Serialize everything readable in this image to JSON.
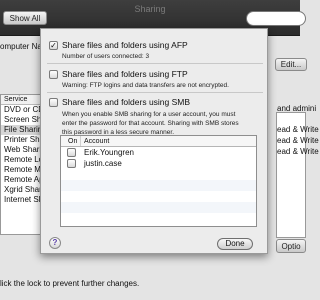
{
  "window": {
    "title": "Sharing",
    "show_all_label": "Show All"
  },
  "background": {
    "computer_name_label": "omputer Na",
    "edit_button_label": "Edit...",
    "service_header": "Service",
    "services": [
      "DVD or CD",
      "Screen Sha",
      "File Sharing",
      "Printer Sha",
      "Web Sharin",
      "Remote Lo",
      "Remote Ma",
      "Remote Ap",
      "Xgrid Shari",
      "Internet Sh"
    ],
    "right_fragments": [
      "and admini",
      "ead & Write",
      "ead & Write",
      "ead & Write"
    ],
    "options_button_label": "Optio",
    "lock_text": "lick the lock to prevent further changes."
  },
  "sheet": {
    "afp": {
      "label": "Share files and folders using AFP",
      "checked": true,
      "users_connected": "Number of users connected: 3"
    },
    "ftp": {
      "label": "Share files and folders using FTP",
      "checked": false,
      "warning": "Warning: FTP logins and data transfers are not encrypted."
    },
    "smb": {
      "label": "Share files and folders using SMB",
      "checked": false,
      "description": "When you enable SMB sharing for a user account, you must enter the password for that account. Sharing with SMB stores this password in a less secure manner."
    },
    "table": {
      "col_on": "On",
      "col_account": "Account",
      "accounts": [
        {
          "name": "Erik.Youngren",
          "on": false
        },
        {
          "name": "justin.case",
          "on": false
        }
      ]
    },
    "help_symbol": "?",
    "done_label": "Done"
  }
}
